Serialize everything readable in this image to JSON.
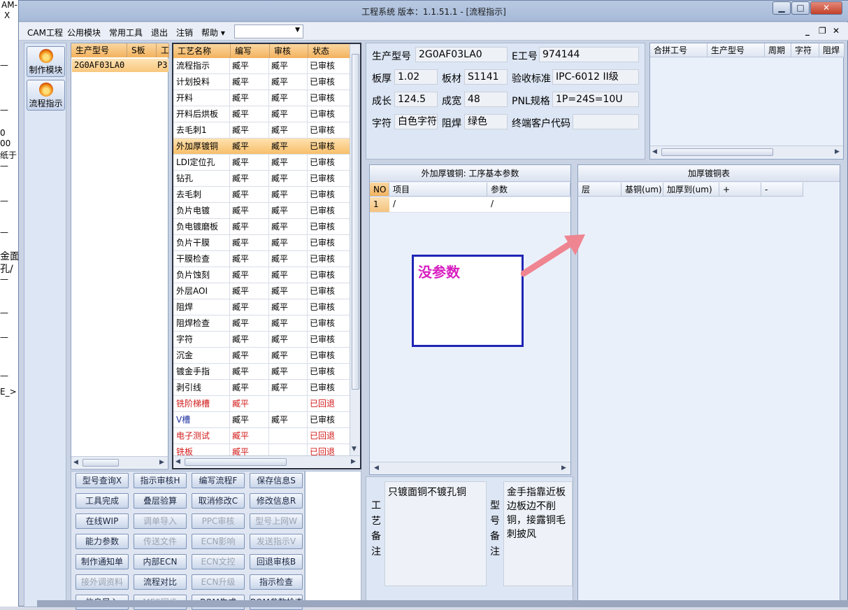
{
  "window": {
    "title": "工程系统   版本：1.1.51.1 - [流程指示]",
    "min_glyph": "▁",
    "max_glyph": "□",
    "close_glyph": "✕"
  },
  "background_window": {
    "fragments": [
      "AM-",
      "X",
      "—",
      "—",
      "0",
      "00",
      "纸于",
      "—",
      "—",
      "—",
      "金面",
      "孔/",
      "—",
      "—",
      "—",
      "—",
      "E_>"
    ]
  },
  "menu": {
    "items": [
      "CAM工程",
      "公用模块",
      "常用工具",
      "退出",
      "注销",
      "帮助 ▾"
    ],
    "select_value": "",
    "mdi_min": "_",
    "mdi_restore": "❐",
    "mdi_close": "✕"
  },
  "launcher": {
    "items": [
      {
        "label": "制作模块",
        "icon": "flame-icon"
      },
      {
        "label": "流程指示",
        "icon": "flame-icon"
      }
    ]
  },
  "model_list": {
    "headers": [
      "生产型号",
      "S板",
      "工"
    ],
    "rows": [
      [
        "2G0AF03LA0",
        "",
        "P3"
      ]
    ]
  },
  "process_list": {
    "headers": [
      "工艺名称",
      "编写",
      "审核",
      "状态"
    ],
    "rows": [
      {
        "name": "流程指示",
        "writer": "臧平",
        "reviewer": "臧平",
        "status": "已审核",
        "style": ""
      },
      {
        "name": "计划投料",
        "writer": "臧平",
        "reviewer": "臧平",
        "status": "已审核",
        "style": ""
      },
      {
        "name": "开料",
        "writer": "臧平",
        "reviewer": "臧平",
        "status": "已审核",
        "style": ""
      },
      {
        "name": "开料后烘板",
        "writer": "臧平",
        "reviewer": "臧平",
        "status": "已审核",
        "style": ""
      },
      {
        "name": "去毛刺1",
        "writer": "臧平",
        "reviewer": "臧平",
        "status": "已审核",
        "style": ""
      },
      {
        "name": "外加厚镀铜",
        "writer": "臧平",
        "reviewer": "臧平",
        "status": "已审核",
        "style": "sel"
      },
      {
        "name": "LDI定位孔",
        "writer": "臧平",
        "reviewer": "臧平",
        "status": "已审核",
        "style": ""
      },
      {
        "name": "钻孔",
        "writer": "臧平",
        "reviewer": "臧平",
        "status": "已审核",
        "style": ""
      },
      {
        "name": "去毛刺",
        "writer": "臧平",
        "reviewer": "臧平",
        "status": "已审核",
        "style": ""
      },
      {
        "name": "负片电镀",
        "writer": "臧平",
        "reviewer": "臧平",
        "status": "已审核",
        "style": ""
      },
      {
        "name": "负电镀磨板",
        "writer": "臧平",
        "reviewer": "臧平",
        "status": "已审核",
        "style": ""
      },
      {
        "name": "负片干膜",
        "writer": "臧平",
        "reviewer": "臧平",
        "status": "已审核",
        "style": ""
      },
      {
        "name": "干膜检查",
        "writer": "臧平",
        "reviewer": "臧平",
        "status": "已审核",
        "style": ""
      },
      {
        "name": "负片蚀刻",
        "writer": "臧平",
        "reviewer": "臧平",
        "status": "已审核",
        "style": ""
      },
      {
        "name": "外层AOI",
        "writer": "臧平",
        "reviewer": "臧平",
        "status": "已审核",
        "style": ""
      },
      {
        "name": "阻焊",
        "writer": "臧平",
        "reviewer": "臧平",
        "status": "已审核",
        "style": ""
      },
      {
        "name": "阻焊检查",
        "writer": "臧平",
        "reviewer": "臧平",
        "status": "已审核",
        "style": ""
      },
      {
        "name": "字符",
        "writer": "臧平",
        "reviewer": "臧平",
        "status": "已审核",
        "style": ""
      },
      {
        "name": "沉金",
        "writer": "臧平",
        "reviewer": "臧平",
        "status": "已审核",
        "style": ""
      },
      {
        "name": "镀金手指",
        "writer": "臧平",
        "reviewer": "臧平",
        "status": "已审核",
        "style": ""
      },
      {
        "name": "剥引线",
        "writer": "臧平",
        "reviewer": "臧平",
        "status": "已审核",
        "style": ""
      },
      {
        "name": "铣阶梯槽",
        "writer": "臧平",
        "reviewer": "",
        "status": "已回退",
        "style": "red"
      },
      {
        "name": "V槽",
        "writer": "臧平",
        "reviewer": "臧平",
        "status": "已审核",
        "style": "blue"
      },
      {
        "name": "电子测试",
        "writer": "臧平",
        "reviewer": "",
        "status": "已回退",
        "style": "red"
      },
      {
        "name": "铣板",
        "writer": "臧平",
        "reviewer": "",
        "status": "已回退",
        "style": "red"
      }
    ]
  },
  "buttons": [
    {
      "label": "型号查询X",
      "enabled": true
    },
    {
      "label": "指示审核H",
      "enabled": true
    },
    {
      "label": "编写流程F",
      "enabled": true
    },
    {
      "label": "保存信息S",
      "enabled": true
    },
    {
      "label": "工具完成",
      "enabled": true
    },
    {
      "label": "叠层验算",
      "enabled": true
    },
    {
      "label": "取消修改C",
      "enabled": true
    },
    {
      "label": "修改信息R",
      "enabled": true
    },
    {
      "label": "在线WIP",
      "enabled": true
    },
    {
      "label": "调单导入",
      "enabled": false
    },
    {
      "label": "PPC审核",
      "enabled": false
    },
    {
      "label": "型号上网W",
      "enabled": false
    },
    {
      "label": "能力参数",
      "enabled": true
    },
    {
      "label": "传送文件",
      "enabled": false
    },
    {
      "label": "ECN影响",
      "enabled": false
    },
    {
      "label": "发送指示V",
      "enabled": false
    },
    {
      "label": "制作通知单",
      "enabled": true
    },
    {
      "label": "内部ECN",
      "enabled": true
    },
    {
      "label": "ECN文控",
      "enabled": false
    },
    {
      "label": "回退审核B",
      "enabled": true
    },
    {
      "label": "接外调资料",
      "enabled": false
    },
    {
      "label": "流程对比",
      "enabled": true
    },
    {
      "label": "ECN升级",
      "enabled": false
    },
    {
      "label": "指示检查",
      "enabled": true
    },
    {
      "label": "信息导入",
      "enabled": true
    },
    {
      "label": "MES同步",
      "enabled": false
    },
    {
      "label": "BOM生成",
      "enabled": true
    },
    {
      "label": "BOM参数检查",
      "enabled": true
    }
  ],
  "info": {
    "fields": [
      {
        "label": "生产型号",
        "value": "2G0AF03LA0"
      },
      {
        "label": "E工号",
        "value": "974144"
      },
      {
        "label": "板厚",
        "value": "1.02"
      },
      {
        "label": "板材",
        "value": "S1141"
      },
      {
        "label": "验收标准",
        "value": "IPC-6012 II级"
      },
      {
        "label": "成长",
        "value": "124.5"
      },
      {
        "label": "成宽",
        "value": "48"
      },
      {
        "label": "PNL规格",
        "value": "1P=24S=10U"
      },
      {
        "label": "字符",
        "value": "白色字符"
      },
      {
        "label": "阻焊",
        "value": "绿色"
      },
      {
        "label": "终端客户代码",
        "value": ""
      }
    ]
  },
  "merge_table": {
    "headers": [
      "合拼工号",
      "生产型号",
      "周期",
      "字符",
      "阻焊"
    ]
  },
  "params": {
    "title": "外加厚镀铜: 工序基本参数",
    "headers": [
      "NO",
      "项目",
      "参数"
    ],
    "rows": [
      [
        "1",
        "/",
        "/"
      ]
    ]
  },
  "copper_table": {
    "title": "加厚镀铜表",
    "headers": [
      "层",
      "基铜(um)",
      "加厚到(um)",
      "+",
      "-"
    ]
  },
  "notes": {
    "process_label": "工艺备注",
    "process_note": "只镀面铜不镀孔铜",
    "model_label": "型号备注",
    "model_note": "金手指靠近板边板边不削铜，接露铜毛刺披风"
  },
  "annotation": {
    "text": "没参数"
  }
}
